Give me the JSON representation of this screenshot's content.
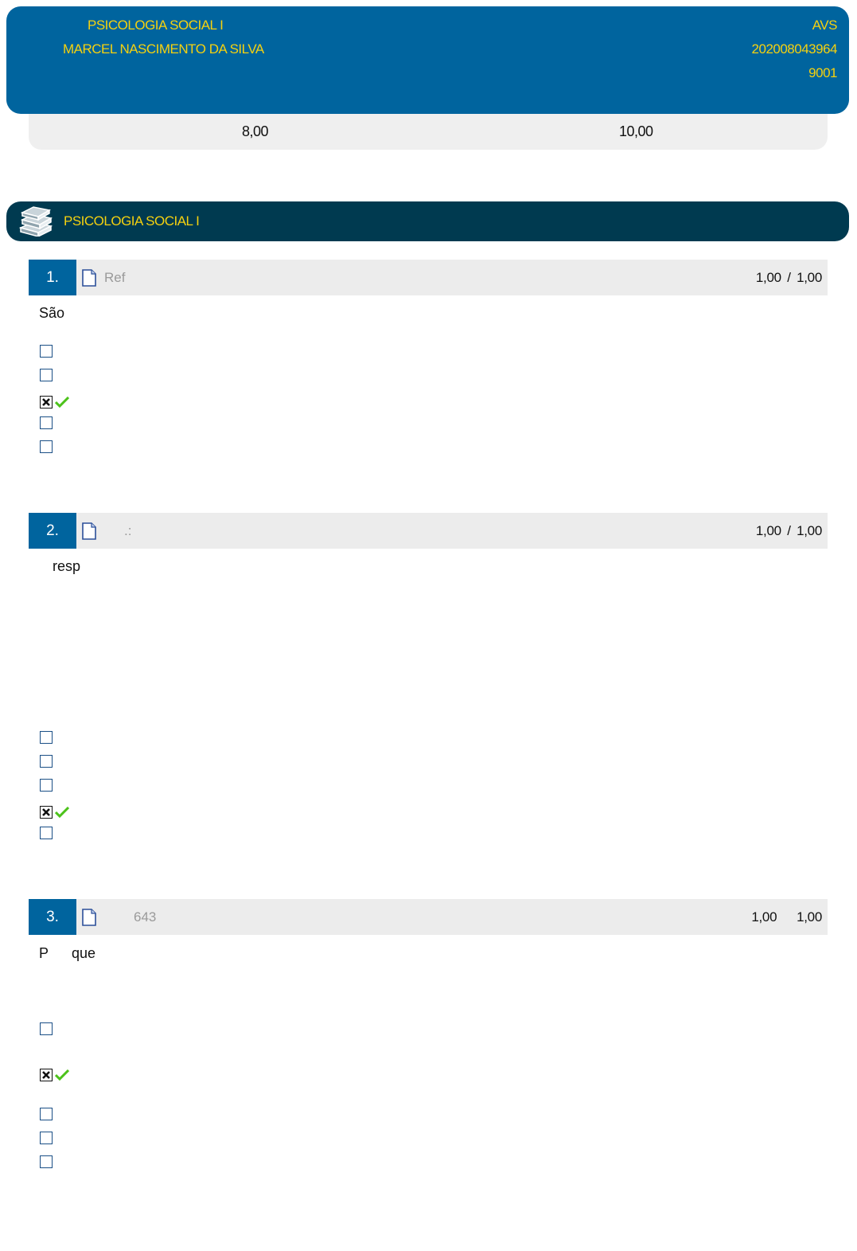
{
  "header": {
    "course": "PSICOLOGIA SOCIAL I",
    "student_name": "MARCEL NASCIMENTO DA SILVA",
    "exam_type": "AVS",
    "registration": "202008043964",
    "class_code": "9001"
  },
  "scores": {
    "grade": "8,00",
    "total": "10,00"
  },
  "section": {
    "title": "PSICOLOGIA SOCIAL I",
    "icon": "books-icon"
  },
  "questions": [
    {
      "number": "1.",
      "ref": "Ref",
      "score": "1,00",
      "separator": "/",
      "max": "1,00",
      "text": "São",
      "checked_option": 3
    },
    {
      "number": "2.",
      "ref": ".:",
      "score": "1,00",
      "separator": "/",
      "max": "1,00",
      "text": "resp",
      "checked_option": 4
    },
    {
      "number": "3.",
      "ref": "643",
      "score": "1,00",
      "separator": "",
      "max": "1,00",
      "text_a": "P",
      "text_b": "que",
      "checked_option": 2
    }
  ],
  "colors": {
    "header_blue": "#00649e",
    "section_dark": "#003a50",
    "title_yellow": "#f5d10f",
    "bar_grey": "#ececec",
    "check_green": "#4cc21a"
  }
}
